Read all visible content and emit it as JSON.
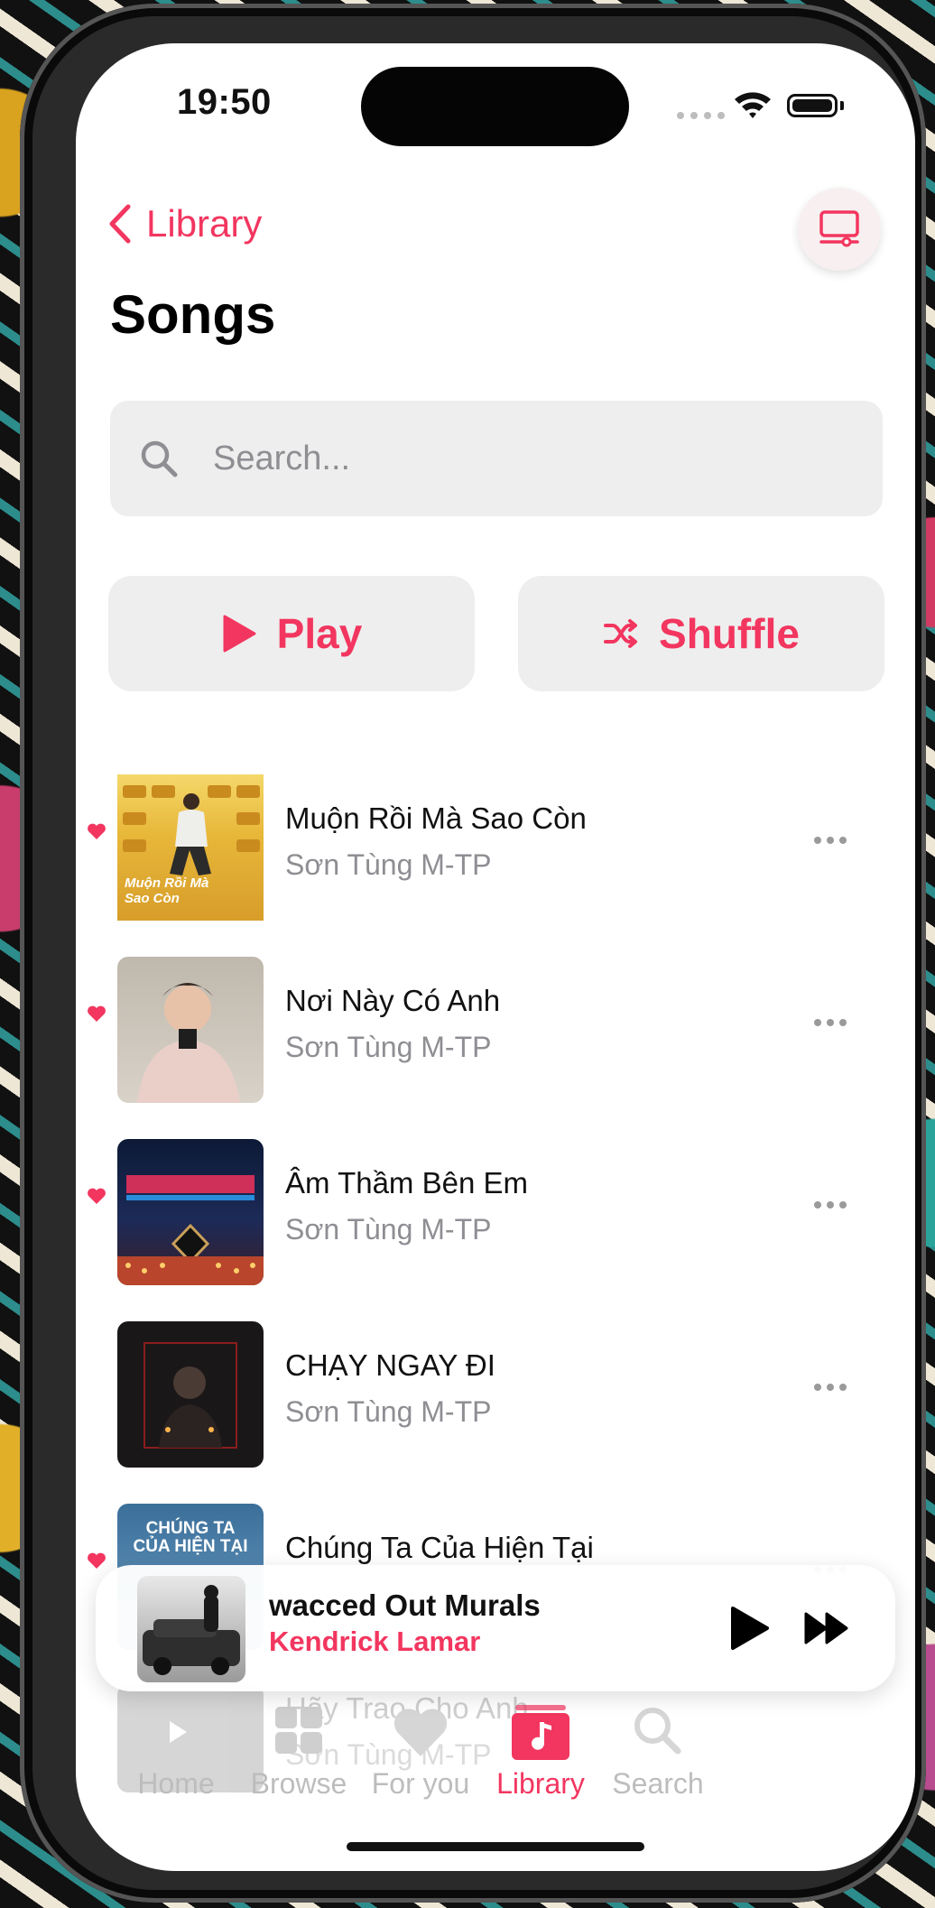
{
  "status_bar": {
    "time": "19:50"
  },
  "nav": {
    "back_label": "Library"
  },
  "page": {
    "title": "Songs"
  },
  "search": {
    "placeholder": "Search..."
  },
  "actions": {
    "play_label": "Play",
    "shuffle_label": "Shuffle"
  },
  "songs": [
    {
      "title": "Muộn Rồi Mà Sao Còn",
      "artist": "Sơn Tùng M-TP",
      "favorite": true
    },
    {
      "title": "Nơi Này Có Anh",
      "artist": "Sơn Tùng M-TP",
      "favorite": true
    },
    {
      "title": "Âm Thầm Bên Em",
      "artist": "Sơn Tùng M-TP",
      "favorite": true
    },
    {
      "title": "CHẠY NGAY ĐI",
      "artist": "Sơn Tùng M-TP",
      "favorite": false
    },
    {
      "title": "Chúng Ta Của Hiện Tại",
      "artist": "",
      "favorite": true
    },
    {
      "title": "Hãy Trao Cho Anh",
      "artist": "Sơn Tùng M-TP",
      "favorite": false
    }
  ],
  "album_art_text": {
    "art1": "Muộn Rồi Mà Sao Còn",
    "art5": "CHÚNG TA CỦA HIỆN TẠI"
  },
  "now_playing": {
    "title": "wacced Out Murals",
    "artist": "Kendrick Lamar"
  },
  "tabs": [
    {
      "label": "Home",
      "icon": "play-circle-icon"
    },
    {
      "label": "Browse",
      "icon": "grid-icon"
    },
    {
      "label": "For you",
      "icon": "heart-icon"
    },
    {
      "label": "Library",
      "icon": "music-note-icon"
    },
    {
      "label": "Search",
      "icon": "search-icon"
    }
  ],
  "colors": {
    "accent": "#f2365f",
    "secondary_text": "#8e8e93",
    "button_bg": "#eeeeee"
  }
}
